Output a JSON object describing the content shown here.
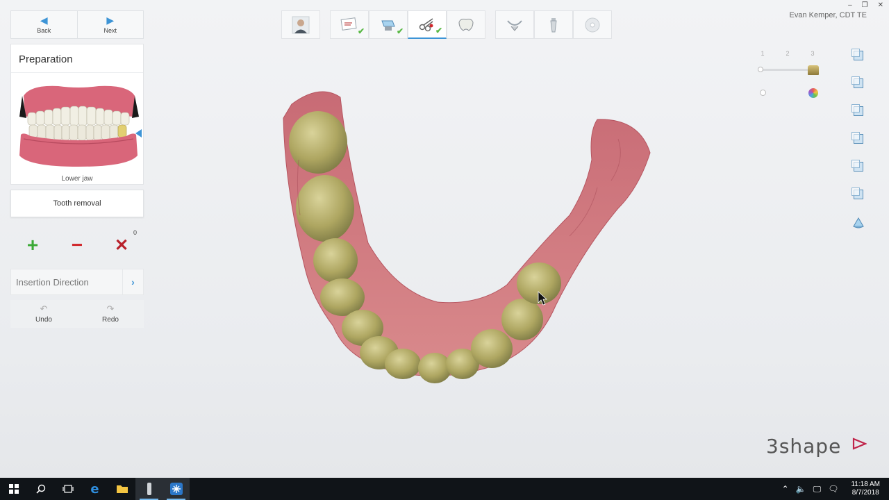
{
  "window": {
    "user": "Evan Kemper, CDT TE",
    "controls": [
      "–",
      "❐",
      "✕"
    ]
  },
  "nav": {
    "back_label": "Back",
    "next_label": "Next"
  },
  "workflow": {
    "steps": [
      {
        "name": "patient",
        "completed": false
      },
      {
        "name": "order",
        "completed": true
      },
      {
        "name": "scan",
        "completed": true
      },
      {
        "name": "preparation",
        "completed": true,
        "active": true
      },
      {
        "name": "crown-design",
        "completed": false
      },
      {
        "name": "articulator",
        "completed": false
      },
      {
        "name": "implant",
        "completed": false
      },
      {
        "name": "finish",
        "completed": false
      }
    ]
  },
  "preparation": {
    "title": "Preparation",
    "jaw_label": "Lower jaw",
    "tooth_removal_label": "Tooth removal",
    "count": "0",
    "add_glyph": "+",
    "remove_glyph": "−",
    "clear_glyph": "✕",
    "insertion_label": "Insertion Direction",
    "undo_label": "Undo",
    "redo_label": "Redo"
  },
  "view": {
    "levels": [
      "1",
      "2",
      "3"
    ]
  },
  "brand": {
    "logo": "3shape"
  },
  "taskbar": {
    "time": "11:18 AM",
    "date": "8/7/2018"
  },
  "colors": {
    "accent": "#3d94d6",
    "add": "#3aa935",
    "remove": "#d0262b",
    "check": "#5ab946"
  }
}
